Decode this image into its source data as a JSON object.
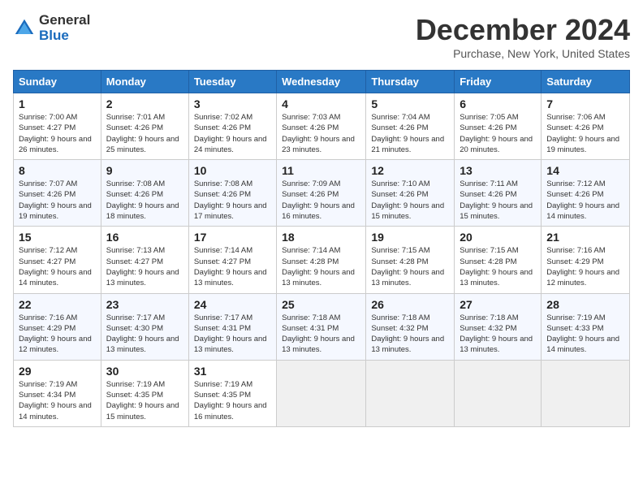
{
  "header": {
    "logo_general": "General",
    "logo_blue": "Blue",
    "title": "December 2024",
    "location": "Purchase, New York, United States"
  },
  "days_of_week": [
    "Sunday",
    "Monday",
    "Tuesday",
    "Wednesday",
    "Thursday",
    "Friday",
    "Saturday"
  ],
  "weeks": [
    [
      {
        "day": "1",
        "sunrise": "7:00 AM",
        "sunset": "4:27 PM",
        "daylight": "9 hours and 26 minutes."
      },
      {
        "day": "2",
        "sunrise": "7:01 AM",
        "sunset": "4:26 PM",
        "daylight": "9 hours and 25 minutes."
      },
      {
        "day": "3",
        "sunrise": "7:02 AM",
        "sunset": "4:26 PM",
        "daylight": "9 hours and 24 minutes."
      },
      {
        "day": "4",
        "sunrise": "7:03 AM",
        "sunset": "4:26 PM",
        "daylight": "9 hours and 23 minutes."
      },
      {
        "day": "5",
        "sunrise": "7:04 AM",
        "sunset": "4:26 PM",
        "daylight": "9 hours and 21 minutes."
      },
      {
        "day": "6",
        "sunrise": "7:05 AM",
        "sunset": "4:26 PM",
        "daylight": "9 hours and 20 minutes."
      },
      {
        "day": "7",
        "sunrise": "7:06 AM",
        "sunset": "4:26 PM",
        "daylight": "9 hours and 19 minutes."
      }
    ],
    [
      {
        "day": "8",
        "sunrise": "7:07 AM",
        "sunset": "4:26 PM",
        "daylight": "9 hours and 19 minutes."
      },
      {
        "day": "9",
        "sunrise": "7:08 AM",
        "sunset": "4:26 PM",
        "daylight": "9 hours and 18 minutes."
      },
      {
        "day": "10",
        "sunrise": "7:08 AM",
        "sunset": "4:26 PM",
        "daylight": "9 hours and 17 minutes."
      },
      {
        "day": "11",
        "sunrise": "7:09 AM",
        "sunset": "4:26 PM",
        "daylight": "9 hours and 16 minutes."
      },
      {
        "day": "12",
        "sunrise": "7:10 AM",
        "sunset": "4:26 PM",
        "daylight": "9 hours and 15 minutes."
      },
      {
        "day": "13",
        "sunrise": "7:11 AM",
        "sunset": "4:26 PM",
        "daylight": "9 hours and 15 minutes."
      },
      {
        "day": "14",
        "sunrise": "7:12 AM",
        "sunset": "4:26 PM",
        "daylight": "9 hours and 14 minutes."
      }
    ],
    [
      {
        "day": "15",
        "sunrise": "7:12 AM",
        "sunset": "4:27 PM",
        "daylight": "9 hours and 14 minutes."
      },
      {
        "day": "16",
        "sunrise": "7:13 AM",
        "sunset": "4:27 PM",
        "daylight": "9 hours and 13 minutes."
      },
      {
        "day": "17",
        "sunrise": "7:14 AM",
        "sunset": "4:27 PM",
        "daylight": "9 hours and 13 minutes."
      },
      {
        "day": "18",
        "sunrise": "7:14 AM",
        "sunset": "4:28 PM",
        "daylight": "9 hours and 13 minutes."
      },
      {
        "day": "19",
        "sunrise": "7:15 AM",
        "sunset": "4:28 PM",
        "daylight": "9 hours and 13 minutes."
      },
      {
        "day": "20",
        "sunrise": "7:15 AM",
        "sunset": "4:28 PM",
        "daylight": "9 hours and 13 minutes."
      },
      {
        "day": "21",
        "sunrise": "7:16 AM",
        "sunset": "4:29 PM",
        "daylight": "9 hours and 12 minutes."
      }
    ],
    [
      {
        "day": "22",
        "sunrise": "7:16 AM",
        "sunset": "4:29 PM",
        "daylight": "9 hours and 12 minutes."
      },
      {
        "day": "23",
        "sunrise": "7:17 AM",
        "sunset": "4:30 PM",
        "daylight": "9 hours and 13 minutes."
      },
      {
        "day": "24",
        "sunrise": "7:17 AM",
        "sunset": "4:31 PM",
        "daylight": "9 hours and 13 minutes."
      },
      {
        "day": "25",
        "sunrise": "7:18 AM",
        "sunset": "4:31 PM",
        "daylight": "9 hours and 13 minutes."
      },
      {
        "day": "26",
        "sunrise": "7:18 AM",
        "sunset": "4:32 PM",
        "daylight": "9 hours and 13 minutes."
      },
      {
        "day": "27",
        "sunrise": "7:18 AM",
        "sunset": "4:32 PM",
        "daylight": "9 hours and 13 minutes."
      },
      {
        "day": "28",
        "sunrise": "7:19 AM",
        "sunset": "4:33 PM",
        "daylight": "9 hours and 14 minutes."
      }
    ],
    [
      {
        "day": "29",
        "sunrise": "7:19 AM",
        "sunset": "4:34 PM",
        "daylight": "9 hours and 14 minutes."
      },
      {
        "day": "30",
        "sunrise": "7:19 AM",
        "sunset": "4:35 PM",
        "daylight": "9 hours and 15 minutes."
      },
      {
        "day": "31",
        "sunrise": "7:19 AM",
        "sunset": "4:35 PM",
        "daylight": "9 hours and 16 minutes."
      },
      null,
      null,
      null,
      null
    ]
  ]
}
